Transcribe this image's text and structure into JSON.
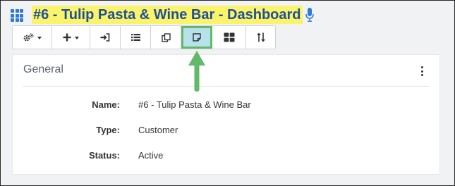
{
  "header": {
    "title": "#6 - Tulip Pasta & Wine Bar - Dashboard",
    "app_icon": "grid-icon",
    "voice_icon": "microphone-icon"
  },
  "toolbar": {
    "buttons": [
      {
        "icon": "cogs-icon",
        "has_dropdown": true
      },
      {
        "icon": "plus-icon",
        "has_dropdown": true
      },
      {
        "icon": "sign-in-icon",
        "has_dropdown": false
      },
      {
        "icon": "list-icon",
        "has_dropdown": false
      },
      {
        "icon": "copy-icon",
        "has_dropdown": false
      },
      {
        "icon": "sticky-note-icon",
        "has_dropdown": false,
        "highlighted": true
      },
      {
        "icon": "th-large-icon",
        "has_dropdown": false
      },
      {
        "icon": "sort-icon",
        "has_dropdown": false
      }
    ]
  },
  "card": {
    "title": "General",
    "menu_icon": "vertical-ellipsis-icon",
    "fields": [
      {
        "label": "Name:",
        "value": "#6 - Tulip Pasta & Wine Bar"
      },
      {
        "label": "Type:",
        "value": "Customer"
      },
      {
        "label": "Status:",
        "value": "Active"
      }
    ]
  },
  "colors": {
    "title_highlight": "#fbf36a",
    "title_text": "#1d4f9a",
    "accent_blue": "#2e7bd6",
    "highlight_button_bg": "#b7e2ec",
    "annotation_green": "#63b96a",
    "page_background": "#f1f2f4"
  }
}
